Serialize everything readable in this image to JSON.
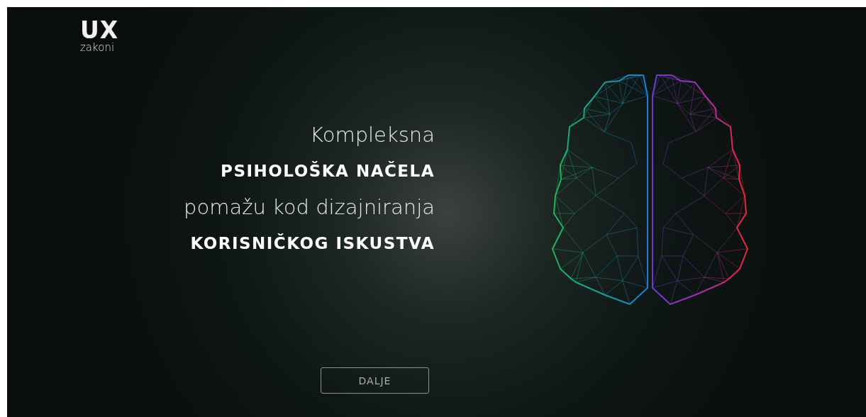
{
  "logo": {
    "mark": "UX",
    "caption": "zakoni"
  },
  "headline": [
    {
      "text": "Kompleksna",
      "kind": "light"
    },
    {
      "text": "PSIHOLOŠKA NAČELA",
      "kind": "bold"
    },
    {
      "text": "pomažu kod dizajniranja",
      "kind": "light"
    },
    {
      "text": "KORISNIČKOG ISKUSTVA",
      "kind": "bold"
    }
  ],
  "button": {
    "label": "DALJE"
  }
}
